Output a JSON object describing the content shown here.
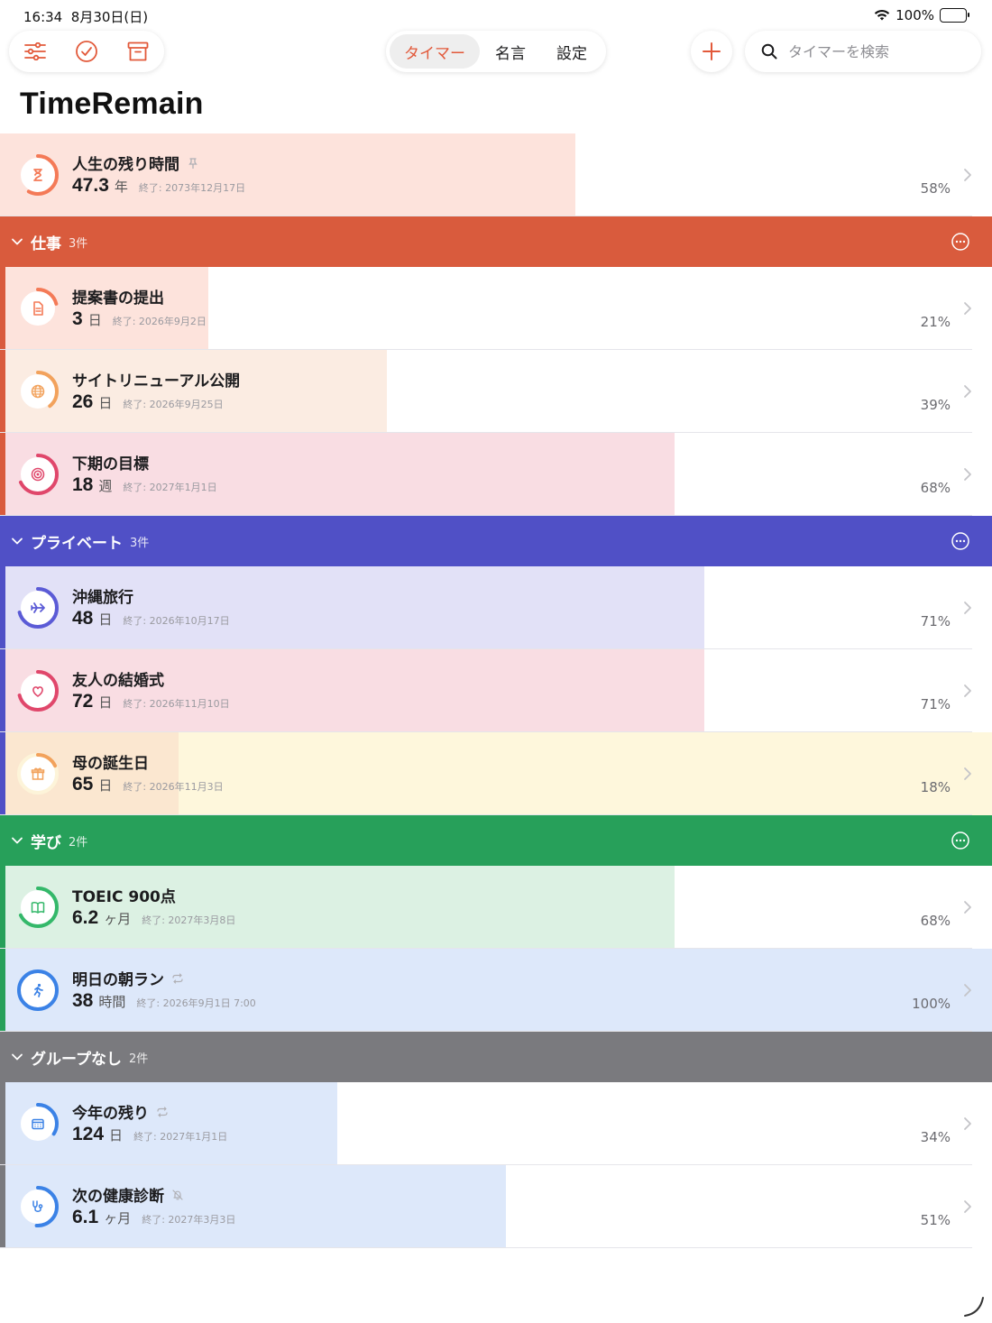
{
  "status": {
    "time": "16:34",
    "date": "8月30日(日)",
    "battery": "100%"
  },
  "toolbar": {
    "tabs": [
      {
        "label": "タイマー",
        "active": true
      },
      {
        "label": "名言"
      },
      {
        "label": "設定"
      }
    ],
    "search_placeholder": "タイマーを検索",
    "accent_color": "#e2593a"
  },
  "app_title": "TimeRemain",
  "pinned": {
    "title": "人生の残り時間",
    "value": "47.3",
    "unit": "年",
    "end": "終了: 2073年12月17日",
    "percent": "58%",
    "progress": 0.58,
    "icon": "hourglass-icon",
    "color": "#f47a57",
    "bg": "#fde3dc"
  },
  "groups": [
    {
      "name": "仕事",
      "count": "3件",
      "color": "#d95b3d",
      "items": [
        {
          "title": "提案書の提出",
          "value": "3",
          "unit": "日",
          "end": "終了: 2026年9月2日",
          "percent": "21%",
          "progress": 0.21,
          "icon": "document-icon",
          "color": "#f47a57",
          "bg": "#fde3dc"
        },
        {
          "title": "サイトリニューアル公開",
          "value": "26",
          "unit": "日",
          "end": "終了: 2026年9月25日",
          "percent": "39%",
          "progress": 0.39,
          "icon": "globe-icon",
          "color": "#f2a25c",
          "bg": "#fbece2"
        },
        {
          "title": "下期の目標",
          "value": "18",
          "unit": "週",
          "end": "終了: 2027年1月1日",
          "percent": "68%",
          "progress": 0.68,
          "icon": "target-icon",
          "color": "#e0476b",
          "bg": "#f9dde3"
        }
      ]
    },
    {
      "name": "プライベート",
      "count": "3件",
      "color": "#5050c6",
      "items": [
        {
          "title": "沖縄旅行",
          "value": "48",
          "unit": "日",
          "end": "終了: 2026年10月17日",
          "percent": "71%",
          "progress": 0.71,
          "icon": "airplane-icon",
          "color": "#5b5bd6",
          "bg": "#e2e1f7"
        },
        {
          "title": "友人の結婚式",
          "value": "72",
          "unit": "日",
          "end": "終了: 2026年11月10日",
          "percent": "71%",
          "progress": 0.71,
          "icon": "heart-icon",
          "color": "#e0476b",
          "bg": "#f9dde3"
        },
        {
          "title": "母の誕生日",
          "value": "65",
          "unit": "日",
          "end": "終了: 2026年11月3日",
          "percent": "18%",
          "progress": 0.18,
          "icon": "gift-icon",
          "color": "#f2a25c",
          "bg": "#fdf4d9",
          "rowbg": "#fef7dc",
          "barbg": "#fbe7d0"
        }
      ]
    },
    {
      "name": "学び",
      "count": "2件",
      "color": "#27a05a",
      "items": [
        {
          "title": "TOEIC 900点",
          "value": "6.2",
          "unit": "ヶ月",
          "end": "終了: 2027年3月8日",
          "percent": "68%",
          "progress": 0.68,
          "icon": "book-icon",
          "color": "#34b86a",
          "bg": "#dcf1e3"
        },
        {
          "title": "明日の朝ラン",
          "value": "38",
          "unit": "時間",
          "end": "終了: 2026年9月1日 7:00",
          "percent": "100%",
          "progress": 1.0,
          "icon": "runner-icon",
          "color": "#3b82e6",
          "bg": "#dde8fa",
          "repeat": true
        }
      ]
    },
    {
      "name": "グループなし",
      "count": "2件",
      "color": "#7a7a7e",
      "items": [
        {
          "title": "今年の残り",
          "value": "124",
          "unit": "日",
          "end": "終了: 2027年1月1日",
          "percent": "34%",
          "progress": 0.34,
          "icon": "calendar-icon",
          "color": "#3b82e6",
          "bg": "#dde8fa",
          "repeat": true
        },
        {
          "title": "次の健康診断",
          "value": "6.1",
          "unit": "ヶ月",
          "end": "終了: 2027年3月3日",
          "percent": "51%",
          "progress": 0.51,
          "icon": "stethoscope-icon",
          "color": "#3b82e6",
          "bg": "#dde8fa",
          "muted": true
        }
      ]
    }
  ]
}
